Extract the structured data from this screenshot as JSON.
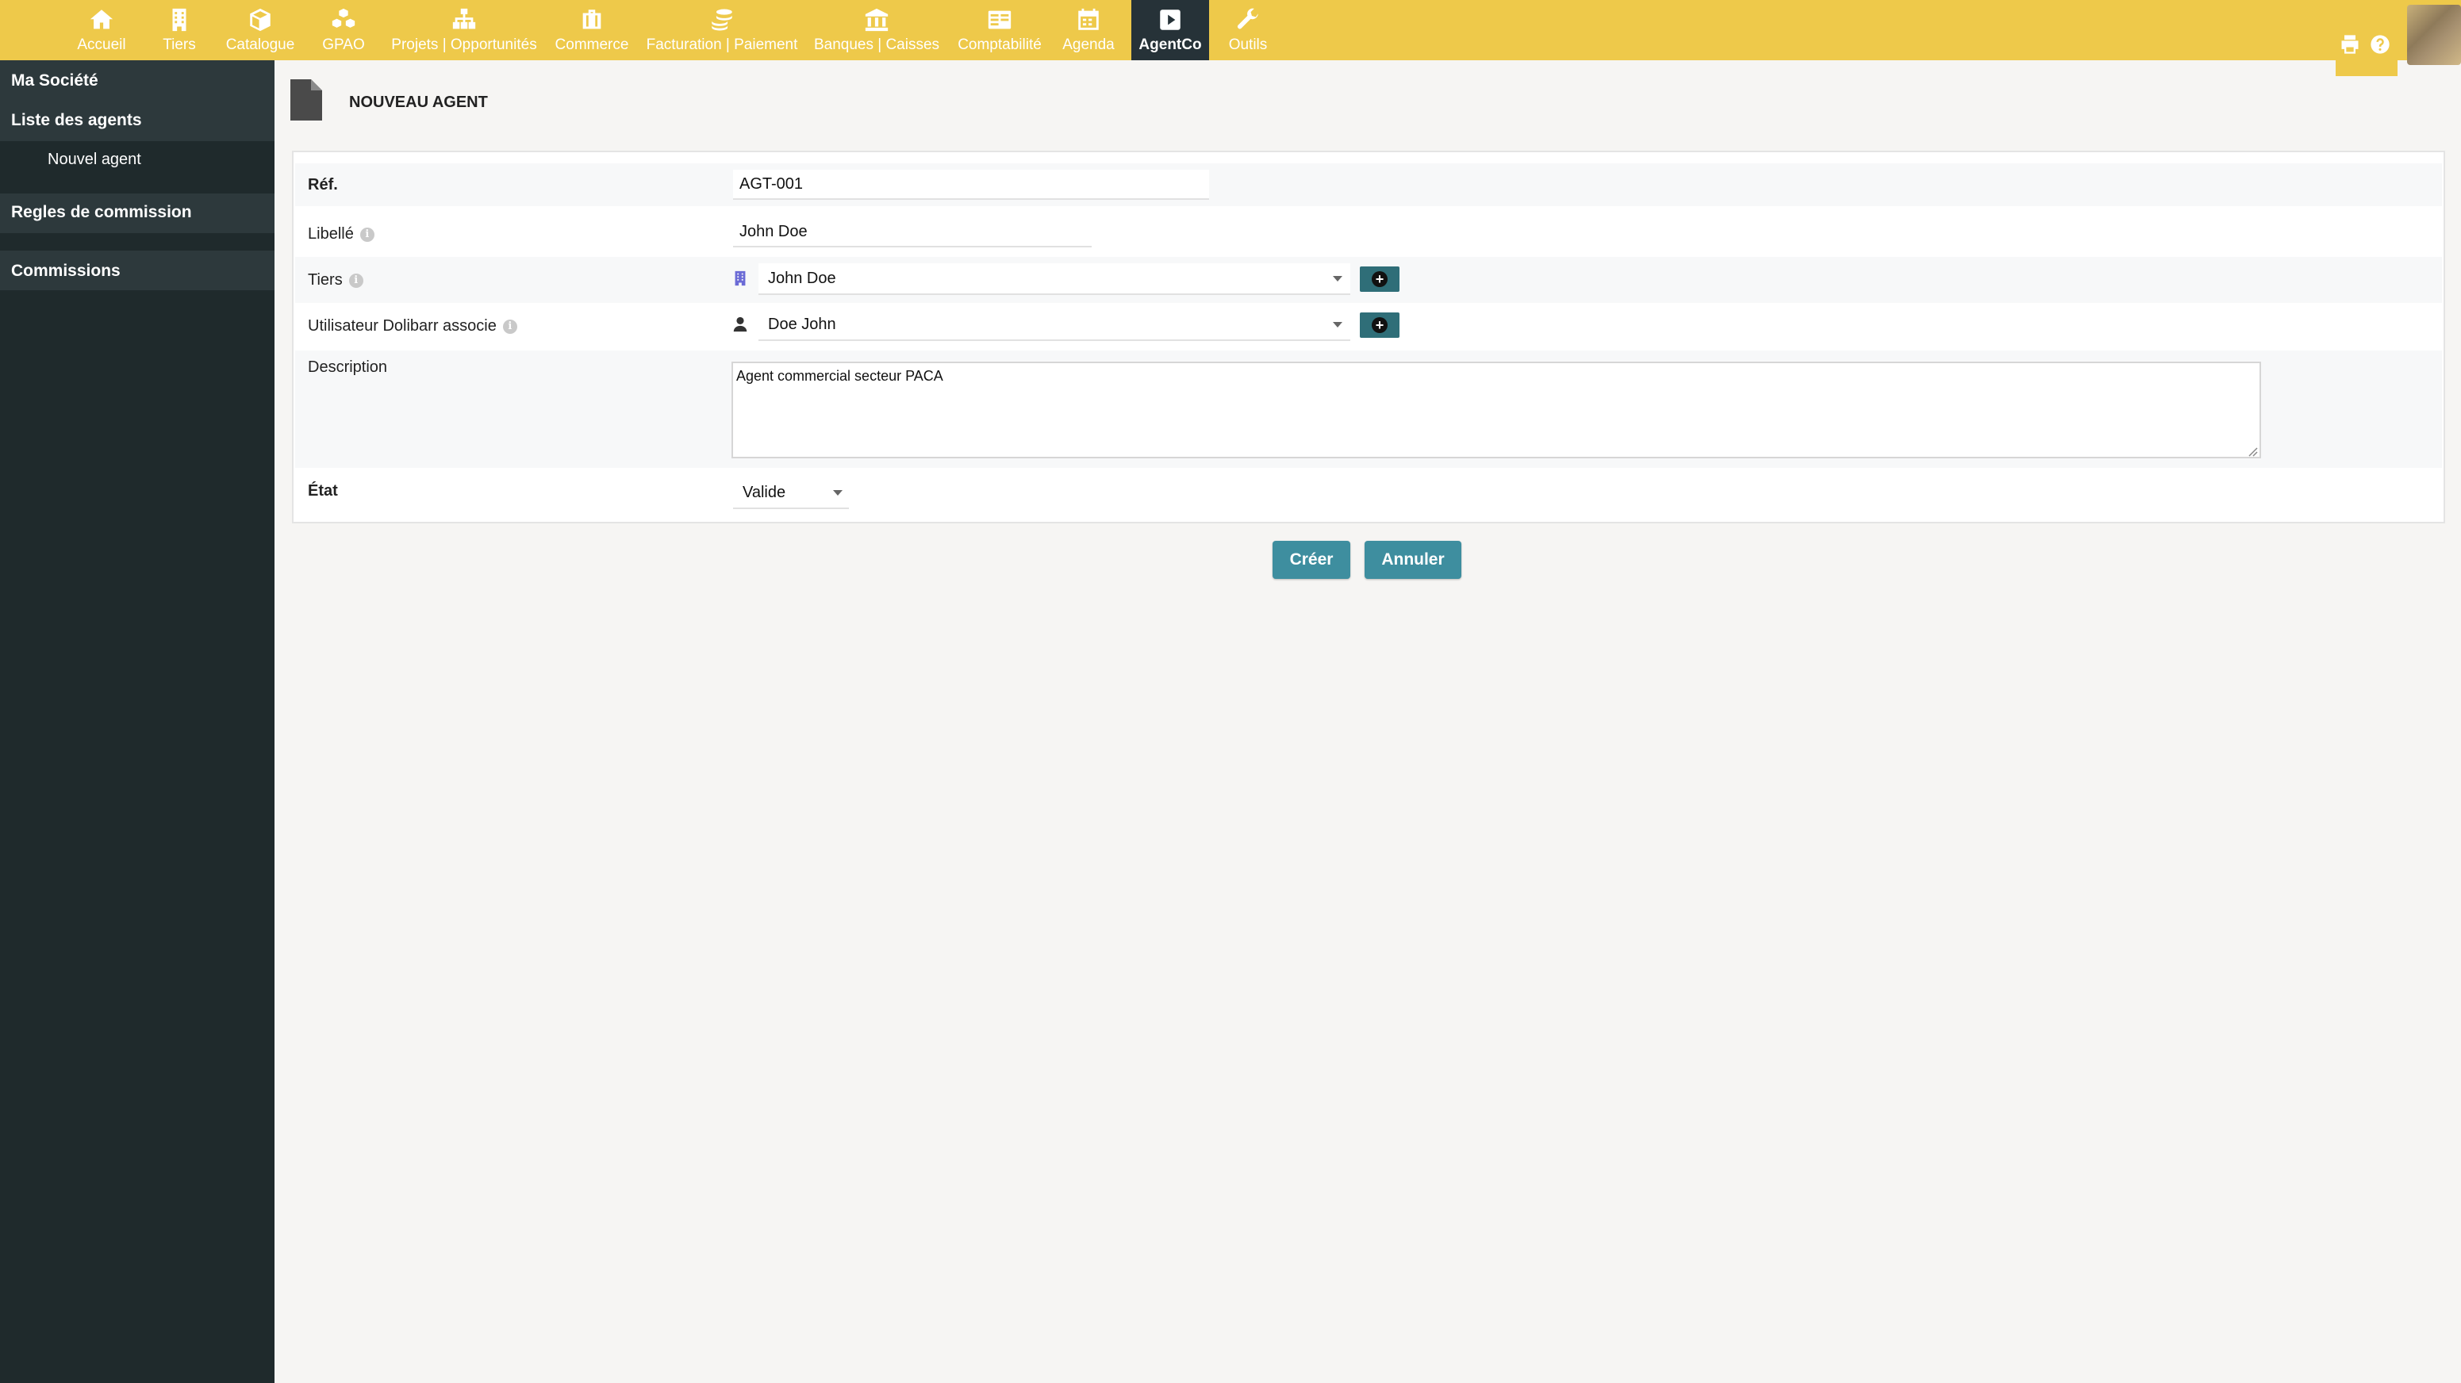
{
  "colors": {
    "topbar": "#eec94a",
    "sidebar": "#1f2a2c",
    "active_tab": "#263238",
    "button": "#3e8e9f"
  },
  "nav": {
    "items": [
      {
        "label": "Accueil",
        "icon": "home-icon"
      },
      {
        "label": "Tiers",
        "icon": "building-icon"
      },
      {
        "label": "Catalogue",
        "icon": "cube-icon"
      },
      {
        "label": "GPAO",
        "icon": "cubes-icon"
      },
      {
        "label": "Projets | Opportunités",
        "icon": "sitemap-icon"
      },
      {
        "label": "Commerce",
        "icon": "briefcase-icon"
      },
      {
        "label": "Facturation | Paiement",
        "icon": "coins-icon"
      },
      {
        "label": "Banques | Caisses",
        "icon": "bank-icon"
      },
      {
        "label": "Comptabilité",
        "icon": "ledger-icon"
      },
      {
        "label": "Agenda",
        "icon": "calendar-icon"
      },
      {
        "label": "AgentCo",
        "icon": "play-square-icon",
        "active": true
      },
      {
        "label": "Outils",
        "icon": "wrench-icon"
      }
    ]
  },
  "sidebar": {
    "company": "Ma Société",
    "agents_list": "Liste des agents",
    "new_agent": "Nouvel agent",
    "commission_rules": "Regles de commission",
    "commissions": "Commissions"
  },
  "page": {
    "title": "NOUVEAU AGENT"
  },
  "form": {
    "ref_label": "Réf.",
    "ref_value": "AGT-001",
    "libelle_label": "Libellé",
    "libelle_value": "John Doe",
    "tiers_label": "Tiers",
    "tiers_value": "John Doe",
    "user_label": "Utilisateur Dolibarr associe",
    "user_value": "Doe John",
    "description_label": "Description",
    "description_value": "Agent commercial secteur PACA",
    "etat_label": "État",
    "etat_value": "Valide"
  },
  "actions": {
    "create": "Créer",
    "cancel": "Annuler"
  }
}
